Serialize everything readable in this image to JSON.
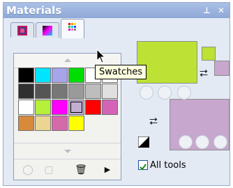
{
  "window": {
    "title": "Materials",
    "pin_glyph": "⊥",
    "close_glyph": "✕"
  },
  "tabs": [
    {
      "name": "colors-tab",
      "icon": "color-picker-icon"
    },
    {
      "name": "gradient-tab",
      "icon": "gradient-icon"
    },
    {
      "name": "swatches-tab",
      "icon": "swatches-icon",
      "active": true
    }
  ],
  "tooltip": {
    "text": "Swatches"
  },
  "swatches": [
    [
      "#000000",
      "#00e5ff",
      "#a7a4e9",
      "#00dd00",
      "#ffffff",
      "#ffffff"
    ],
    [
      "#303030",
      "#555555",
      "#777777",
      "#9a9a9a",
      "#bdbdbd",
      "#e0e0e0"
    ],
    [
      "#ffffff",
      "#b5f03a",
      "#ff00ff",
      "#c3aed2",
      "#ff0000",
      "#d463b8"
    ],
    [
      "#d78a3a",
      "#ead692",
      "#d46aaa",
      "#ffff00",
      null,
      null
    ]
  ],
  "selected_swatch": {
    "row": 2,
    "col": 3
  },
  "colors": {
    "foreground": "#bde134",
    "background": "#c7a7cd",
    "accent": "#1c4c9a"
  },
  "swap_glyph": "⮂",
  "checkbox": {
    "label": "All tools",
    "checked": true
  }
}
